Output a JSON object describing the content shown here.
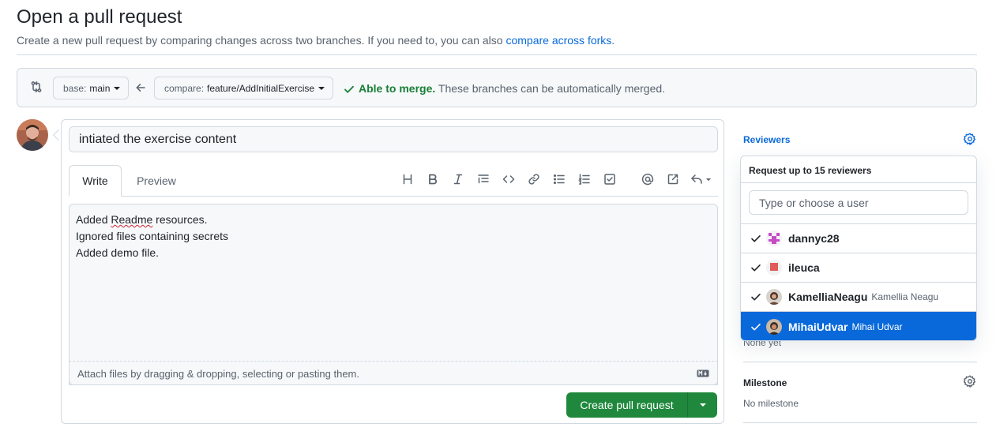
{
  "header": {
    "title": "Open a pull request",
    "subtitle": "Create a new pull request by comparing changes across two branches. If you need to, you can also",
    "subtitle_link": "compare across forks",
    "subtitle_end": "."
  },
  "compare": {
    "base_prefix": "base:",
    "base_branch": "main",
    "compare_prefix": "compare:",
    "compare_branch": "feature/AddInitialExercise",
    "merge_status": "Able to merge.",
    "merge_detail": "These branches can be automatically merged.",
    "icons": [
      "git-compare-icon",
      "arrow-left-icon",
      "check-icon"
    ]
  },
  "editor": {
    "title_value": "intiated the exercise content",
    "tabs": [
      {
        "label": "Write",
        "active": true
      },
      {
        "label": "Preview",
        "active": false
      }
    ],
    "toolbar_icons": [
      "heading-icon",
      "bold-icon",
      "italic-icon",
      "quote-icon",
      "code-icon",
      "link-icon",
      "unordered-list-icon",
      "ordered-list-icon",
      "task-list-icon",
      "mention-icon",
      "reference-icon",
      "reply-icon"
    ],
    "body_line1_prefix": "Added ",
    "body_line1_misspelled": "Readme",
    "body_line1_suffix": " resources.",
    "body_line2": "Ignored files containing secrets",
    "body_line3": "Added demo file.",
    "attach_hint": "Attach files by dragging & dropping, selecting or pasting them.",
    "submit_label": "Create pull request"
  },
  "sidebar": {
    "reviewers_label": "Reviewers",
    "reviewers_value": "None yet",
    "milestone_label": "Milestone",
    "milestone_value": "No milestone"
  },
  "reviewer_dropdown": {
    "header": "Request up to 15 reviewers",
    "search_placeholder": "Type or choose a user",
    "items": [
      {
        "login": "dannyc28",
        "name": "",
        "selected": true,
        "highlighted": false
      },
      {
        "login": "ileuca",
        "name": "",
        "selected": true,
        "highlighted": false
      },
      {
        "login": "KamelliaNeagu",
        "name": "Kamellia Neagu",
        "selected": true,
        "highlighted": false
      },
      {
        "login": "MihaiUdvar",
        "name": "Mihai Udvar",
        "selected": true,
        "highlighted": true
      }
    ]
  },
  "colors": {
    "primary_button": "#1f883d",
    "link": "#0969da",
    "success": "#1a7f37",
    "highlight": "#0969da",
    "border": "#d1d9e0"
  }
}
